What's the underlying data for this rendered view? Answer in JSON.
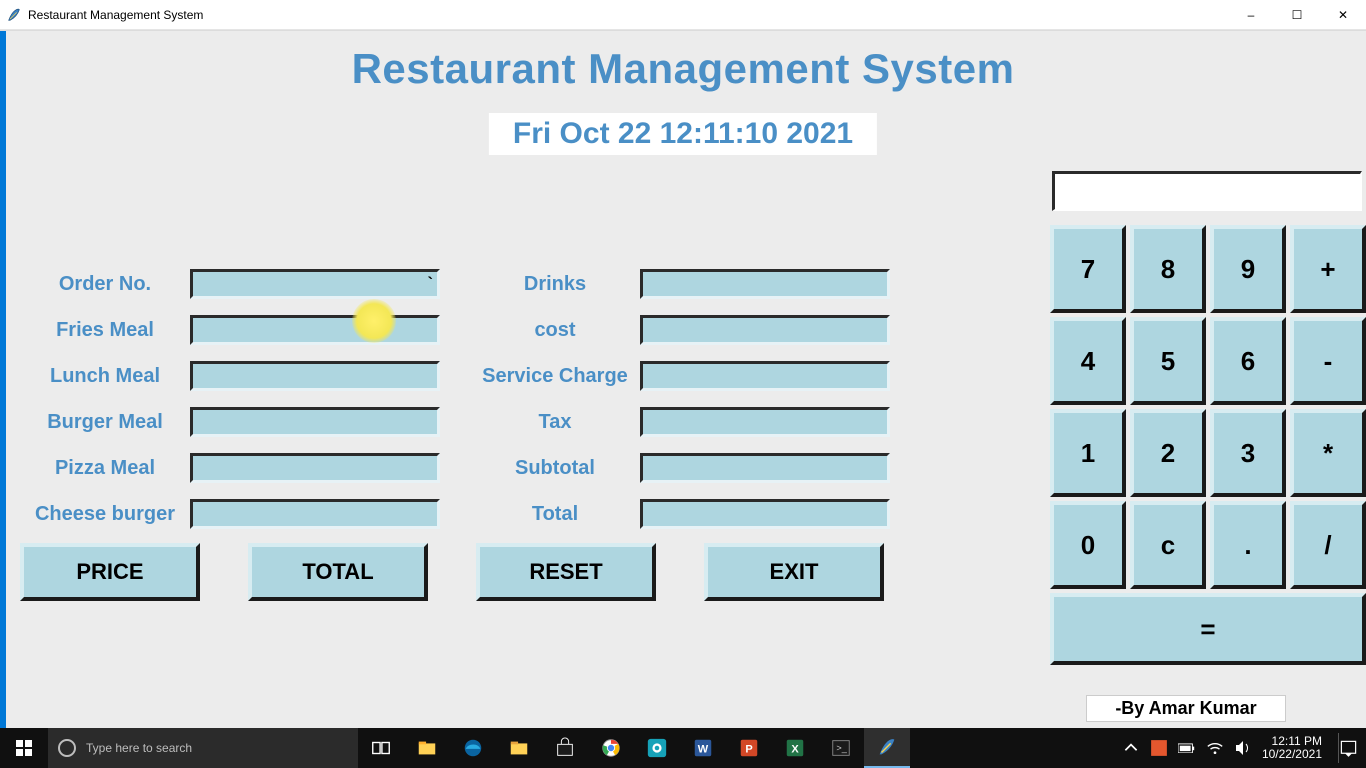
{
  "window": {
    "title": "Restaurant Management System",
    "minimize": "–",
    "maximize": "☐",
    "close": "✕"
  },
  "header": {
    "title": "Restaurant Management System",
    "datetime": "Fri Oct 22 12:11:10 2021"
  },
  "form": {
    "left": [
      {
        "label": "Order No.",
        "value": "`"
      },
      {
        "label": "Fries Meal",
        "value": ""
      },
      {
        "label": "Lunch Meal",
        "value": ""
      },
      {
        "label": "Burger Meal",
        "value": ""
      },
      {
        "label": "Pizza Meal",
        "value": ""
      },
      {
        "label": "Cheese burger",
        "value": ""
      }
    ],
    "right": [
      {
        "label": "Drinks",
        "value": ""
      },
      {
        "label": "cost",
        "value": ""
      },
      {
        "label": "Service Charge",
        "value": ""
      },
      {
        "label": "Tax",
        "value": ""
      },
      {
        "label": "Subtotal",
        "value": ""
      },
      {
        "label": "Total",
        "value": ""
      }
    ]
  },
  "actions": {
    "price": "PRICE",
    "total": "TOTAL",
    "reset": "RESET",
    "exit": "EXIT"
  },
  "calculator": {
    "display": "",
    "buttons": [
      "7",
      "8",
      "9",
      "+",
      "4",
      "5",
      "6",
      "-",
      "1",
      "2",
      "3",
      "*",
      "0",
      "c",
      ".",
      "/"
    ],
    "equals": "="
  },
  "credit": "-By Amar Kumar",
  "taskbar": {
    "search_placeholder": "Type here to search",
    "time": "12:11 PM",
    "date": "10/22/2021"
  }
}
